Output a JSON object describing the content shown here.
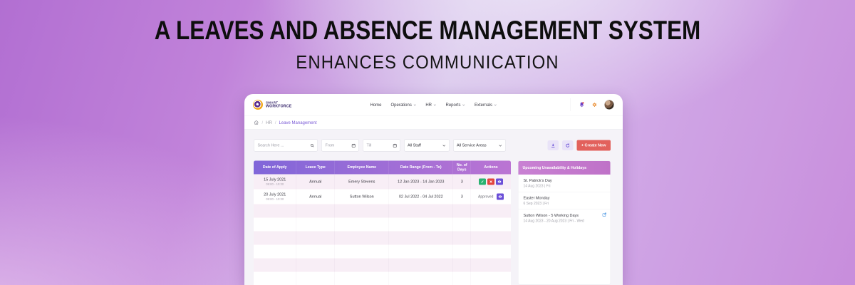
{
  "banner": {
    "title_line1": "A LEAVES AND ABSENCE MANAGEMENT SYSTEM",
    "title_line2": "ENHANCES COMMUNICATION"
  },
  "app": {
    "brand": {
      "name_line1": "SMART",
      "name_line2": "WORKFORCE"
    },
    "nav": {
      "items": [
        {
          "label": "Home",
          "has_dropdown": false
        },
        {
          "label": "Operations",
          "has_dropdown": true
        },
        {
          "label": "HR",
          "has_dropdown": true
        },
        {
          "label": "Reports",
          "has_dropdown": true
        },
        {
          "label": "Externals",
          "has_dropdown": true
        }
      ]
    },
    "navbar_icons": [
      "notifications-bell",
      "settings-gear",
      "user-avatar"
    ],
    "breadcrumb": {
      "sep": "/",
      "hr": "HR",
      "current": "Leave Management"
    },
    "filters": {
      "search_placeholder": "Search Here ...",
      "from_placeholder": "From",
      "till_placeholder": "Till",
      "staff_value": "All Staff",
      "service_value": "All Service Areas"
    },
    "toolbar": {
      "create_label": "+ Create New"
    },
    "table": {
      "columns": [
        "Date of Apply",
        "Leave Type",
        "Employee Name",
        "Date Range (From - To)",
        "No. of Days",
        "Actions"
      ],
      "rows": [
        {
          "date": "15 July 2021",
          "time": "09:00 - 10:30",
          "type": "Annual",
          "employee": "Emery Stevens",
          "range": "12 Jan 2023 - 14 Jan 2023",
          "days": "3",
          "status": "",
          "actions": [
            "approve",
            "reject",
            "view"
          ]
        },
        {
          "date": "20 July 2021",
          "time": "09:00 - 10:30",
          "type": "Annual",
          "employee": "Sutton Wilson",
          "range": "02 Jul 2022 - 04 Jul 2022",
          "days": "3",
          "status": "Approved",
          "actions": [
            "view"
          ]
        }
      ],
      "empty_row_count": 6
    },
    "panel": {
      "title": "Upcoming Unavailability & Holidays",
      "items": [
        {
          "name": "St. Patrick's Day",
          "date": "14 Aug 2023  |  Fri",
          "has_edit": false
        },
        {
          "name": "Easter Monday",
          "date": "6 Sep 2023  |  Fri",
          "has_edit": false
        },
        {
          "name": "Sutton Wilson - 5 Working Days",
          "date": "14 Aug 2023 - 20 Aug 2023  |  Fri - Wed",
          "has_edit": true
        }
      ]
    },
    "colors": {
      "table_header_purple": "#8066d9",
      "panel_header_pink": "#c47acc",
      "create_red": "#e2615c",
      "approve_green": "#2ab272",
      "reject_red": "#e2443f",
      "view_purple": "#6b4fd8",
      "link_purple": "#7a5ad6",
      "logo_orange": "#f2a71b",
      "logo_purple": "#5b2d8e"
    }
  }
}
